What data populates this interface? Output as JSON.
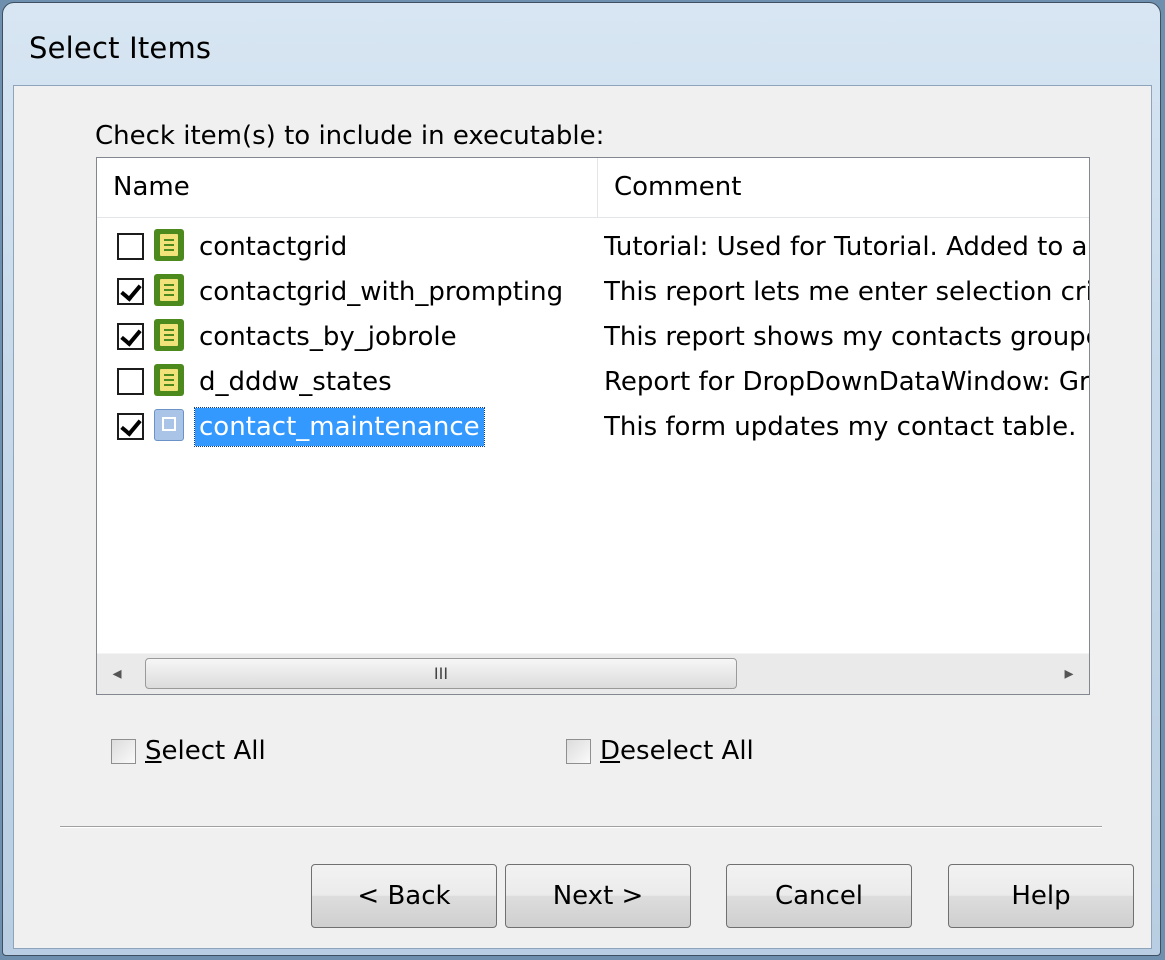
{
  "window": {
    "title": "Select Items"
  },
  "prompt": "Check item(s) to include in executable:",
  "list": {
    "columns": [
      "Name",
      "Comment"
    ],
    "rows": [
      {
        "checked": false,
        "icon": "report-icon",
        "name": "contactgrid",
        "comment": "Tutorial: Used for Tutorial. Added to a",
        "selected": false
      },
      {
        "checked": true,
        "icon": "report-icon",
        "name": "contactgrid_with_prompting",
        "comment": "This report lets me enter selection crite",
        "selected": false
      },
      {
        "checked": true,
        "icon": "report-icon",
        "name": "contacts_by_jobrole",
        "comment": "This report shows my contacts groupe",
        "selected": false
      },
      {
        "checked": false,
        "icon": "report-icon",
        "name": "d_dddw_states",
        "comment": "Report for DropDownDataWindow: Gri",
        "selected": false
      },
      {
        "checked": true,
        "icon": "form-icon",
        "name": "contact_maintenance",
        "comment": "This form updates my contact table.",
        "selected": true
      }
    ],
    "scrollbar": {
      "left_arrow": "◂",
      "right_arrow": "▸",
      "grip": "III"
    }
  },
  "select_all": {
    "label_mnemonic": "S",
    "label_rest": "elect All",
    "checked": false
  },
  "deselect_all": {
    "label_mnemonic": "D",
    "label_rest": "eselect All",
    "checked": false
  },
  "buttons": {
    "back": "< Back",
    "next": "Next >",
    "cancel": "Cancel",
    "help": "Help"
  }
}
